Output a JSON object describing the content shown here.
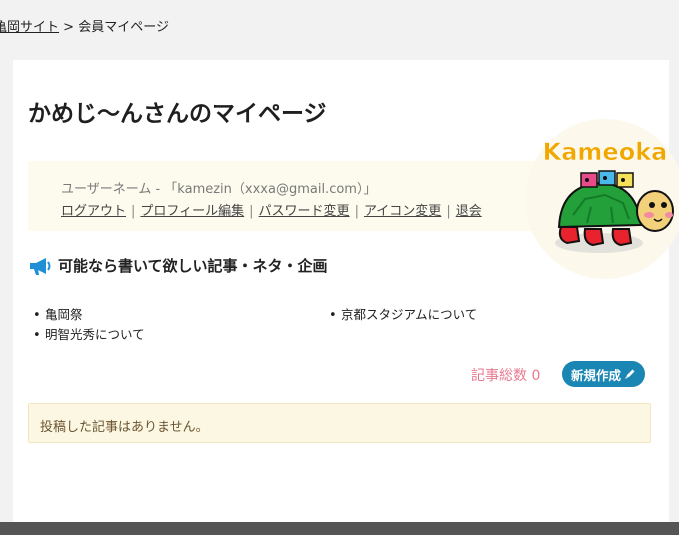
{
  "breadcrumb": {
    "site_link": "亀岡サイト",
    "separator": ">",
    "current": "会員マイページ"
  },
  "page": {
    "title": "かめじ〜んさんのマイページ"
  },
  "user": {
    "info": "ユーザーネーム - 「kamezin（xxxa@gmail.com）」",
    "links": [
      "ログアウト",
      "プロフィール編集",
      "パスワード変更",
      "アイコン変更",
      "退会"
    ],
    "separator": "|"
  },
  "logo": {
    "text": "Kameoka"
  },
  "requests": {
    "icon": "megaphone-icon",
    "heading": "可能なら書いて欲しい記事・ネタ・企画",
    "items": [
      "亀岡祭",
      "明智光秀について",
      "京都スタジアムについて"
    ]
  },
  "articles": {
    "count_label": "記事総数 0",
    "new_button": "新規作成",
    "new_button_icon": "pen-icon",
    "empty_message": "投稿した記事はありません。"
  },
  "colors": {
    "page_bg": "#f2f2f2",
    "card_bg": "#ffffff",
    "user_box_bg": "#fcfbee",
    "megaphone": "#1f8fd6",
    "count": "#e8798f",
    "button": "#1a86b3",
    "notice_bg": "#fcf7e3",
    "notice_border": "#f1e6bf",
    "notice_text": "#6b5531",
    "logo_text": "#f0a800"
  }
}
